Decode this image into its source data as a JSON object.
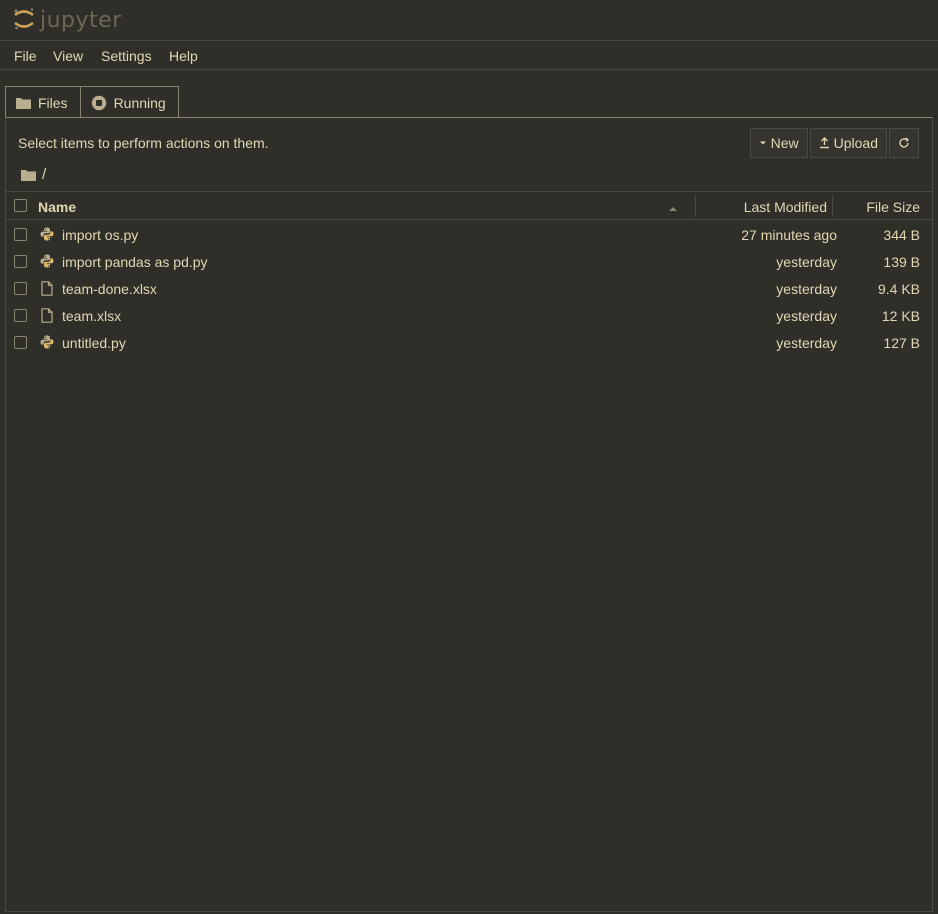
{
  "app": {
    "logo_text": "jupyter"
  },
  "menu": [
    {
      "label": "File"
    },
    {
      "label": "View"
    },
    {
      "label": "Settings"
    },
    {
      "label": "Help"
    }
  ],
  "tabs": [
    {
      "label": "Files",
      "icon": "folder-icon"
    },
    {
      "label": "Running",
      "icon": "stop-circle-icon"
    }
  ],
  "toolbar": {
    "hint": "Select items to perform actions on them.",
    "new_label": "New",
    "upload_label": "Upload",
    "refresh_icon": "refresh-icon"
  },
  "breadcrumb": {
    "path": "/"
  },
  "list": {
    "columns": {
      "name": "Name",
      "modified": "Last Modified",
      "size": "File Size"
    },
    "files": [
      {
        "name": "import os.py",
        "modified": "27 minutes ago",
        "size": "344 B",
        "icon": "python-icon"
      },
      {
        "name": "import pandas as pd.py",
        "modified": "yesterday",
        "size": "139 B",
        "icon": "python-icon"
      },
      {
        "name": "team-done.xlsx",
        "modified": "yesterday",
        "size": "9.4 KB",
        "icon": "file-icon"
      },
      {
        "name": "team.xlsx",
        "modified": "yesterday",
        "size": "12 KB",
        "icon": "file-icon"
      },
      {
        "name": "untitled.py",
        "modified": "yesterday",
        "size": "127 B",
        "icon": "python-icon"
      }
    ]
  },
  "colors": {
    "background": "#2f2e29",
    "text": "#e2d7b3",
    "border": "#4b4940",
    "accent": "#c9a25a"
  }
}
